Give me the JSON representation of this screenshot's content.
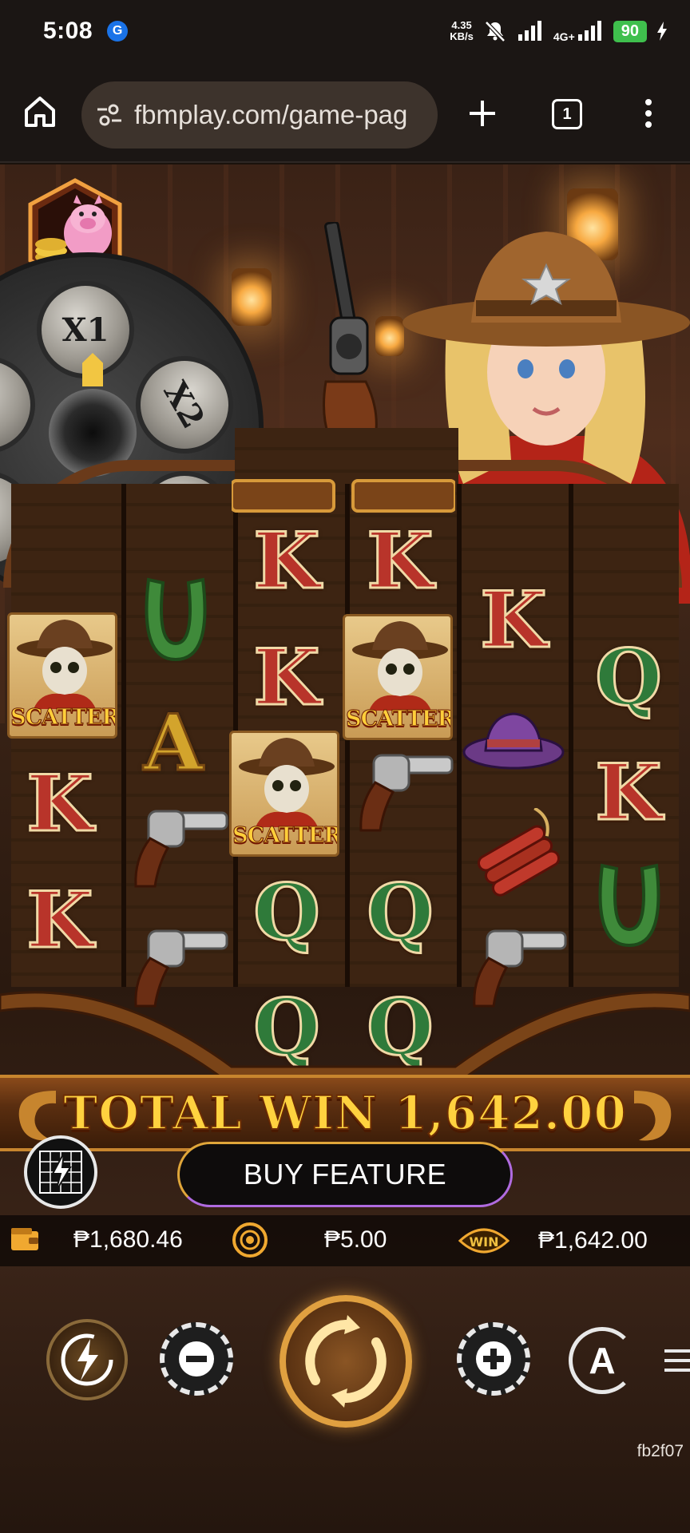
{
  "status_bar": {
    "time": "5:08",
    "network_speed_value": "4.35",
    "network_speed_unit": "KB/s",
    "network_type": "4G+",
    "battery": "90",
    "google_badge": "G"
  },
  "browser": {
    "url": "fbmplay.com/game-pag",
    "tab_count": "1"
  },
  "game": {
    "multipliers": [
      "X1",
      "X2"
    ],
    "reels": [
      [
        "SCATTER",
        "K",
        "K"
      ],
      [
        "horseshoe",
        "A",
        "revolver",
        "revolver"
      ],
      [
        "K",
        "K",
        "SCATTER",
        "Q",
        "Q"
      ],
      [
        "K",
        "SCATTER",
        "revolver",
        "Q",
        "Q"
      ],
      [
        "K",
        "hat",
        "dynamite",
        "revolver"
      ],
      [
        "Q",
        "K",
        "horseshoe"
      ]
    ],
    "scatter_label": "SCATTER",
    "total_win_label": "TOTAL WIN",
    "total_win_value": "1,642.00",
    "buy_feature_label": "BUY FEATURE",
    "balance": "₱1,680.46",
    "bet": "₱5.00",
    "win": "₱1,642.00",
    "win_badge": "WIN",
    "auto_label": "A",
    "session_id": "fb2f07"
  },
  "colors": {
    "accent_gold": "#ffd23f",
    "battery_green": "#3fbf4d",
    "k_red": "#b8342a",
    "q_green": "#2f7a3a"
  }
}
